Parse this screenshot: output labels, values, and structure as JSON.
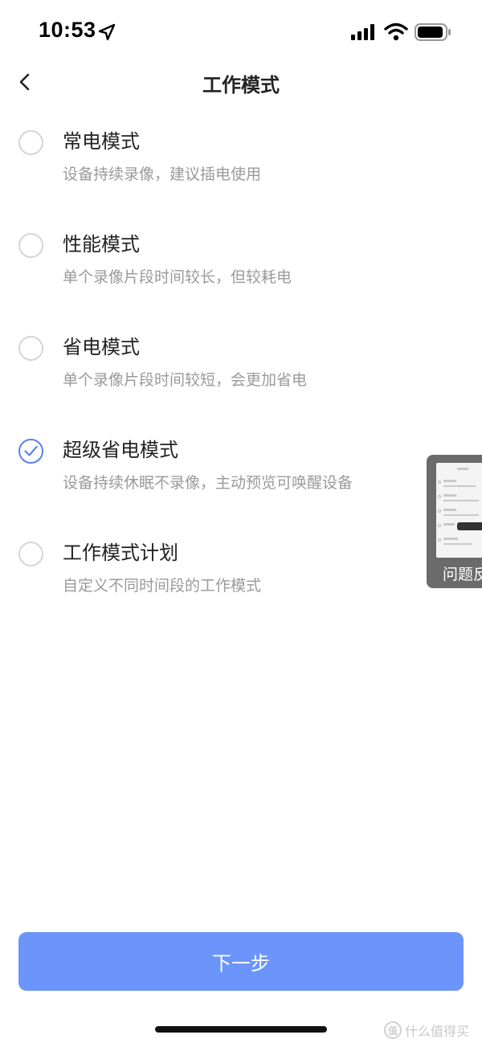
{
  "status_bar": {
    "time": "10:53",
    "icons": [
      "location-arrow-icon",
      "cellular-signal-icon",
      "wifi-icon",
      "battery-icon"
    ]
  },
  "header": {
    "title": "工作模式",
    "back_icon": "chevron-left-icon"
  },
  "options": [
    {
      "title": "常电模式",
      "desc": "设备持续录像，建议插电使用",
      "selected": false
    },
    {
      "title": "性能模式",
      "desc": "单个录像片段时间较长，但较耗电",
      "selected": false
    },
    {
      "title": "省电模式",
      "desc": "单个录像片段时间较短，会更加省电",
      "selected": false
    },
    {
      "title": "超级省电模式",
      "desc": "设备持续休眠不录像，主动预览可唤醒设备",
      "selected": true
    },
    {
      "title": "工作模式计划",
      "desc": "自定义不同时间段的工作模式",
      "selected": false
    }
  ],
  "feedback": {
    "label": "问题反"
  },
  "footer": {
    "next_label": "下一步"
  },
  "watermark": {
    "logo": "值",
    "text": "什么值得买"
  },
  "colors": {
    "accent": "#5b82f0",
    "button": "#6c95fb",
    "radio_border": "#d6d6d6",
    "desc_text": "#9a9a9a"
  }
}
